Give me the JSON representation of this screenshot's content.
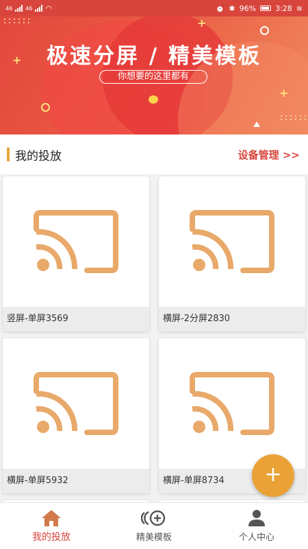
{
  "status_bar": {
    "battery": "96%",
    "time": "3:28",
    "network_left": "46",
    "network_right": "46"
  },
  "banner": {
    "title": "极速分屏 / 精美模板",
    "subtitle": "你想要的这里都有"
  },
  "section": {
    "title": "我的投放",
    "link": "设备管理 >>"
  },
  "cards": [
    {
      "label": "竖屏-单屏3569"
    },
    {
      "label": "横屏-2分屏2830"
    },
    {
      "label": "横屏-单屏5932"
    },
    {
      "label": "横屏-单屏8734"
    }
  ],
  "fab": {
    "label": "+"
  },
  "nav": {
    "items": [
      {
        "label": "我的投放",
        "icon": "home-icon",
        "active": true
      },
      {
        "label": "精美模板",
        "icon": "template-icon",
        "active": false
      },
      {
        "label": "个人中心",
        "icon": "person-icon",
        "active": false
      }
    ]
  },
  "colors": {
    "accent": "#d8453c",
    "cast_icon": "#e8a96a",
    "fab": "#eaa236"
  }
}
